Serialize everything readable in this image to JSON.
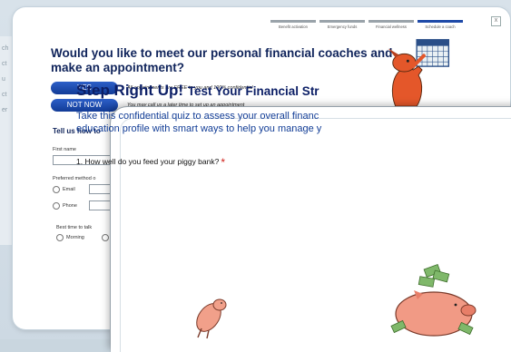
{
  "background": {
    "side_fragments": [
      "ch",
      "ct",
      "u",
      "ct",
      "er"
    ]
  },
  "back_card": {
    "steps": [
      {
        "label": "Benefit activation",
        "active": false
      },
      {
        "label": "Emergency funds",
        "active": false
      },
      {
        "label": "Financial wellness",
        "active": false
      },
      {
        "label": "Schedule a coach",
        "active": true
      }
    ],
    "close_label": "x",
    "title": "Would you like to meet our personal financial coaches and make an appointment?",
    "yes_label": "YES",
    "yes_note": "All appointments are FREE to you and 100% confidential",
    "no_label": "NOT NOW",
    "no_note": "You may call us a later time to set up an appointment",
    "tell_us": "Tell us how to",
    "first_name_label": "First name",
    "preferred_method_label": "Preferred method o",
    "email_label": "Email",
    "phone_label": "Phone",
    "best_time_label": "Best time to talk",
    "morning_label": "Morning"
  },
  "front_card": {
    "title": "Step Right Up!",
    "subtitle": "Test Your Financial Str",
    "desc_line1": "Take this confidential quiz to assess your overall financ",
    "desc_line2": "education profile with smart ways to help you manage y",
    "question": "1. How well do you feed your piggy bank?",
    "required_mark": "*"
  },
  "colors": {
    "navy": "#10245b",
    "accent_blue": "#1f4aa8",
    "required_red": "#d0201a"
  }
}
